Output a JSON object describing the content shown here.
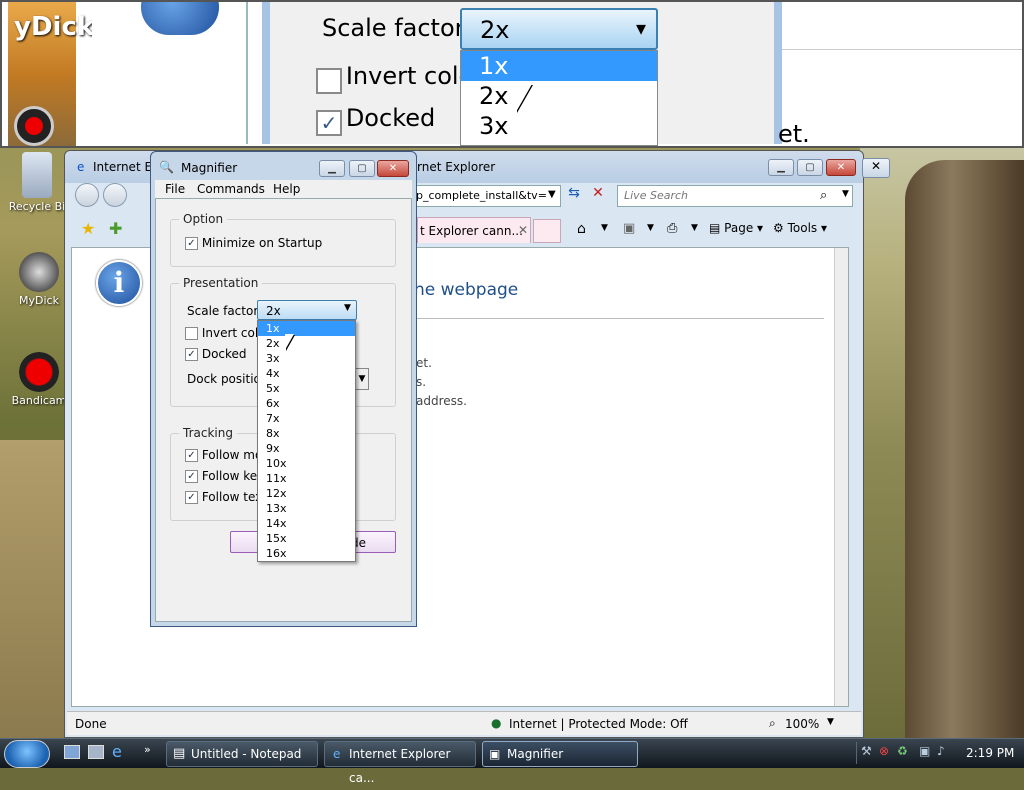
{
  "magnified": {
    "icon_text": "yDick",
    "scale_label": "Scale factor:",
    "scale_value": "2x",
    "invert_label": "Invert colo",
    "docked_label": "Docked",
    "list": [
      "1x",
      "2x",
      "3x"
    ],
    "right_text": "et."
  },
  "desktop": {
    "icons": [
      {
        "label": "Recycle Bi"
      },
      {
        "label": "MyDick"
      },
      {
        "label": "Bandicam"
      }
    ]
  },
  "ie": {
    "title_left": "Internet Ex",
    "title_right": "rnet Explorer",
    "address": "p_complete_install&tv=",
    "search_placeholder": "Live Search",
    "tab_label": "t Explorer cann...",
    "page_label": "Page",
    "tools_label": "Tools",
    "heading": "he webpage",
    "lines": [
      "et.",
      "s.",
      "address."
    ],
    "status_left": "Done",
    "status_zone": "Internet | Protected Mode: Off",
    "zoom": "100%"
  },
  "magnifier": {
    "title": "Magnifier",
    "menu": [
      "File",
      "Commands",
      "Help"
    ],
    "option_group": "Option",
    "minimize_label": "Minimize on Startup",
    "presentation_group": "Presentation",
    "scale_label": "Scale factor:",
    "scale_value": "2x",
    "invert_label": "Invert colo",
    "docked_label": "Docked",
    "dock_position_label": "Dock position",
    "tracking_group": "Tracking",
    "follow_mouse": "Follow mo",
    "follow_keyboard": "Follow key",
    "follow_text": "Follow tex",
    "button_right_text": "de",
    "scale_options": [
      "1x",
      "2x",
      "3x",
      "4x",
      "5x",
      "6x",
      "7x",
      "8x",
      "9x",
      "10x",
      "11x",
      "12x",
      "13x",
      "14x",
      "15x",
      "16x"
    ]
  },
  "taskbar": {
    "items": [
      "Untitled - Notepad",
      "Internet Explorer ca...",
      "Magnifier"
    ],
    "clock": "2:19 PM"
  }
}
